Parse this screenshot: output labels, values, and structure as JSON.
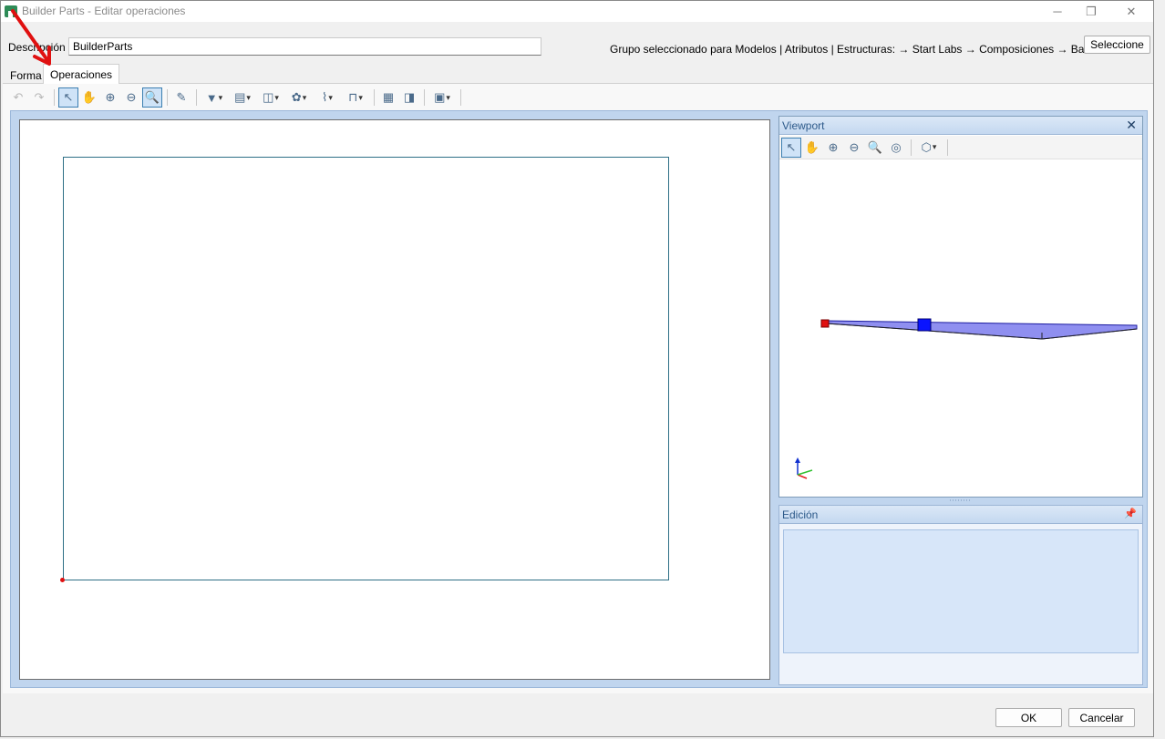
{
  "window": {
    "title": "Builder Parts - Editar operaciones",
    "controls": {
      "minimize": "─",
      "restore": "❐",
      "close": "✕"
    }
  },
  "form": {
    "description_label": "Descripción",
    "description_value": "BuilderParts",
    "group_text": "Grupo seleccionado para Modelos | Atributos | Estructuras: → Start Labs → Composiciones → Bases",
    "select_button": "Seleccione"
  },
  "tabs": [
    {
      "label": "Forma",
      "active": false
    },
    {
      "label": "Operaciones",
      "active": true
    }
  ],
  "toolbar": {
    "undo": "↶",
    "redo": "↷",
    "select": "↖",
    "pan": "✋",
    "zoom_in": "⊕",
    "zoom_out": "⊖",
    "zoom_fit": "🔍",
    "new": "✎",
    "tool1": "▼",
    "tool2": "▤",
    "tool3": "◫",
    "tool4": "✿",
    "tool5": "⌇",
    "tool6": "⊓",
    "tool7": "▦",
    "tool8": "◨",
    "tool9": "▣"
  },
  "viewport": {
    "title": "Viewport",
    "close": "✕",
    "tools": {
      "select": "↖",
      "pan": "✋",
      "zoom_in": "⊕",
      "zoom_out": "⊖",
      "zoom_fit": "🔍",
      "orbit": "◎",
      "view_cube": "⬡"
    }
  },
  "edicion": {
    "title": "Edición",
    "pin": "📌"
  },
  "buttons": {
    "ok": "OK",
    "cancel": "Cancelar"
  },
  "colors": {
    "accent": "#3c7fb1",
    "frame": "#c0d5ee",
    "annotation_arrow": "#e01010"
  }
}
